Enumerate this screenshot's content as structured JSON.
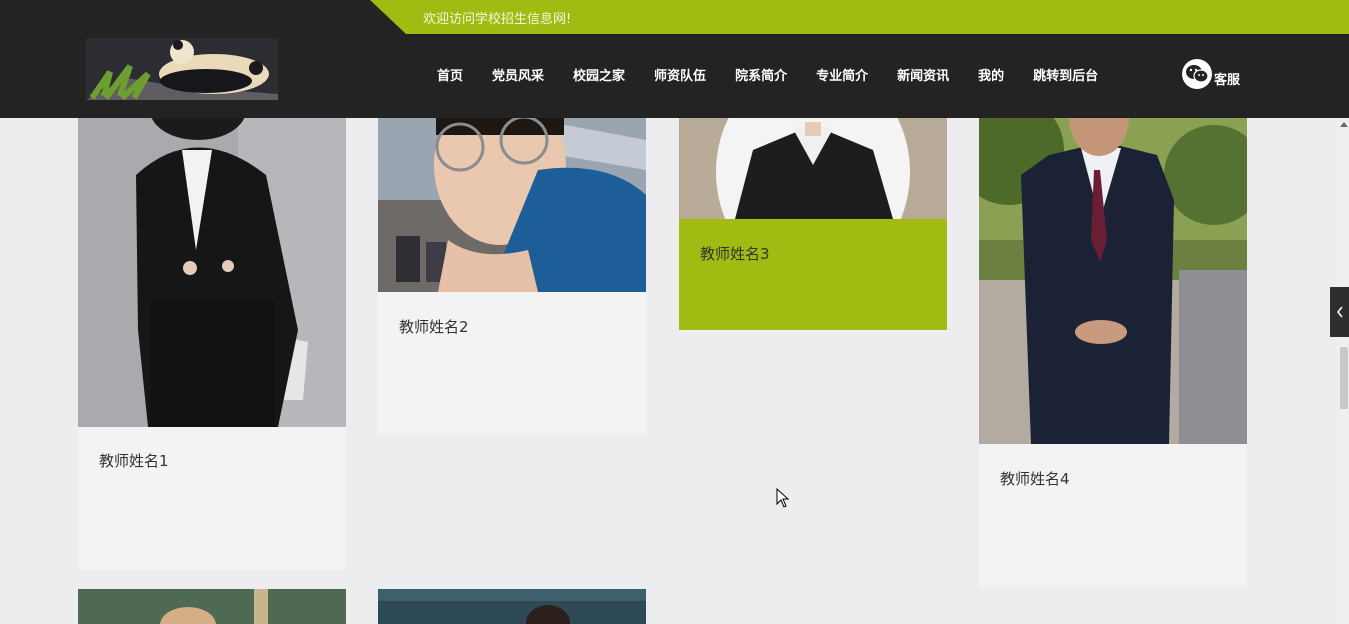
{
  "header": {
    "welcome": "欢迎访问学校招生信息网!",
    "nav": [
      "首页",
      "党员风采",
      "校园之家",
      "师资队伍",
      "院系简介",
      "专业简介",
      "新闻资讯",
      "我的",
      "跳转到后台"
    ],
    "service_label": "客服",
    "accent_color": "#a2bb13"
  },
  "teachers": [
    {
      "name": "教师姓名1"
    },
    {
      "name": "教师姓名2"
    },
    {
      "name": "教师姓名3"
    },
    {
      "name": "教师姓名4"
    }
  ],
  "side_tab_icon": "chevron-left-icon"
}
